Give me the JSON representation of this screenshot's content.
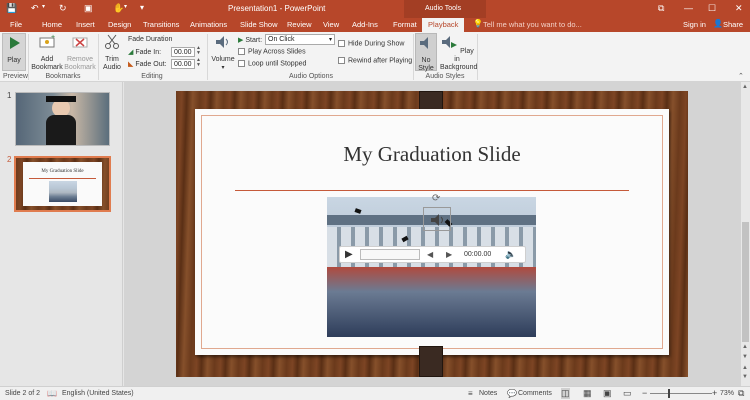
{
  "window": {
    "title": "Presentation1 - PowerPoint",
    "context_label": "Audio Tools",
    "controls": {
      "ribbon_display": "⧉",
      "minimize": "—",
      "maximize": "☐",
      "close": "✕"
    }
  },
  "tabs": [
    "File",
    "Home",
    "Insert",
    "Design",
    "Transitions",
    "Animations",
    "Slide Show",
    "Review",
    "View",
    "Add-Ins",
    "Format",
    "Playback"
  ],
  "active_tab": "Playback",
  "tell_me": "Tell me what you want to do...",
  "sign_in": "Sign in",
  "share": "Share",
  "ribbon": {
    "preview": {
      "play": "Play",
      "group": "Preview"
    },
    "bookmarks": {
      "add": "Add Bookmark",
      "remove": "Remove Bookmark",
      "group": "Bookmarks"
    },
    "editing": {
      "trim": "Trim Audio",
      "fade_duration": "Fade Duration",
      "fade_in_label": "Fade In:",
      "fade_in_value": "00.00",
      "fade_out_label": "Fade Out:",
      "fade_out_value": "00.00",
      "group": "Editing"
    },
    "audio_options": {
      "volume": "Volume",
      "start_label": "Start:",
      "start_value": "On Click",
      "play_across": "Play Across Slides",
      "loop": "Loop until Stopped",
      "hide_during_show": "Hide During Show",
      "rewind": "Rewind after Playing",
      "group": "Audio Options"
    },
    "audio_styles": {
      "no_style": "No Style",
      "play_bg": "Play in Background",
      "group": "Audio Styles"
    }
  },
  "thumbnails": [
    {
      "number": "1",
      "title": ""
    },
    {
      "number": "2",
      "title": "My Graduation Slide"
    }
  ],
  "slide": {
    "title": "My Graduation Slide",
    "player_time": "00:00.00"
  },
  "status": {
    "slide_info": "Slide 2 of 2",
    "language": "English (United States)",
    "notes": "Notes",
    "comments": "Comments",
    "zoom": "73%",
    "zoom_level": 0.73
  },
  "colors": {
    "accent": "#b7472a",
    "rule": "#c55a3a"
  }
}
